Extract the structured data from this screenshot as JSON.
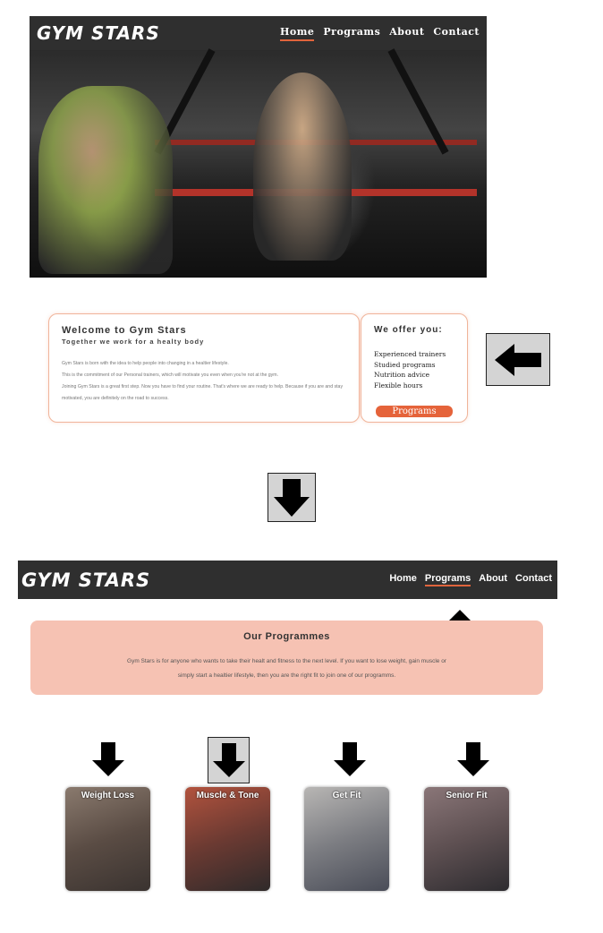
{
  "top_mockup": {
    "logo": "GYM STARS",
    "nav": [
      "Home",
      "Programs",
      "About",
      "Contact"
    ],
    "active_nav": "Home"
  },
  "welcome_card": {
    "title": "Welcome to Gym Stars",
    "subtitle": "Together we work for a healty body",
    "paragraphs": [
      "Gym Stars is born with the idea to help people into changing in a healtier lifestyle.",
      "This is the commitment of our Personal trainers, which will motivate you even when you're not at the gym.",
      "Joining Gym Stars is a great first step. Now you have to find your routine. That's where we are ready to help. Because if you are and stay motivated, you are definitely on the road to success."
    ]
  },
  "offer_card": {
    "title": "We offer you:",
    "items": [
      "Experienced trainers",
      "Studied programs",
      "Nutrition advice",
      "Flexible hours"
    ],
    "button_label": "Programs"
  },
  "bottom_mockup": {
    "logo": "GYM STARS",
    "nav": [
      "Home",
      "Programs",
      "About",
      "Contact"
    ],
    "active_nav": "Programs",
    "programmes_title": "Our Programmes",
    "programmes_text": "Gym Stars is for anyone who wants to take their healt and fitness to the next level. If you want to lose weight, gain muscle or simply start a healtier lifestyle, then you are the right fit to join one of our programms.",
    "tiles": [
      {
        "title": "Weight Loss",
        "color": "#6f5f55"
      },
      {
        "title": "Muscle & Tone",
        "color": "#7a4438"
      },
      {
        "title": "Get Fit",
        "color": "#8b8c90"
      },
      {
        "title": "Senior Fit",
        "color": "#6a5c5e"
      }
    ]
  },
  "annotations": {
    "arrow_color": "#000000",
    "highlight_box_color": "#d4d4d4",
    "accent_color": "#e5633a"
  }
}
